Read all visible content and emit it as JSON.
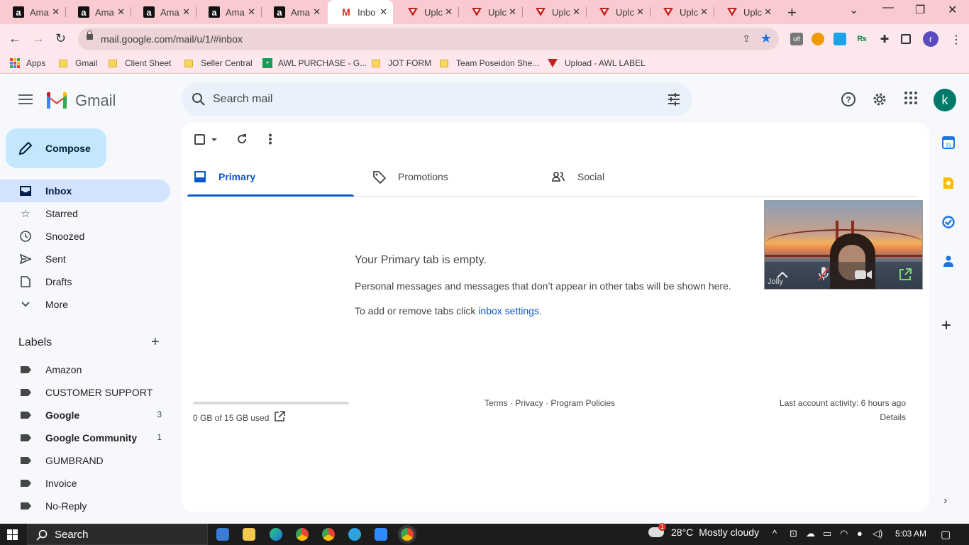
{
  "browser": {
    "tabs": [
      {
        "title": "Ama",
        "favicon": "amazon-icon",
        "active": false
      },
      {
        "title": "Ama",
        "favicon": "amazon-icon",
        "active": false
      },
      {
        "title": "Ama",
        "favicon": "amazon-icon",
        "active": false
      },
      {
        "title": "Ama",
        "favicon": "amazon-icon",
        "active": false
      },
      {
        "title": "Ama",
        "favicon": "amazon-icon",
        "active": false
      },
      {
        "title": "Inbo",
        "favicon": "gmail-icon",
        "active": true
      },
      {
        "title": "Uplc",
        "favicon": "upload-triangle-icon",
        "active": false
      },
      {
        "title": "Uplc",
        "favicon": "upload-triangle-icon",
        "active": false
      },
      {
        "title": "Uplc",
        "favicon": "upload-triangle-icon",
        "active": false
      },
      {
        "title": "Uplc",
        "favicon": "upload-triangle-icon",
        "active": false
      },
      {
        "title": "Uplc",
        "favicon": "upload-triangle-icon",
        "active": false
      },
      {
        "title": "Uplc",
        "favicon": "upload-triangle-icon",
        "active": false
      }
    ],
    "url": "mail.google.com/mail/u/1/#inbox",
    "profile_initial": "r",
    "extension_off_badge": "off",
    "colors": {
      "tabbar": "#f9cbd1",
      "toolbar": "#fce8ec"
    },
    "bookmarks": [
      {
        "label": "Apps",
        "icon": "apps-grid-icon"
      },
      {
        "label": "Gmail",
        "icon": "folder-icon"
      },
      {
        "label": "Client Sheet",
        "icon": "folder-icon"
      },
      {
        "label": "Seller Central",
        "icon": "folder-icon"
      },
      {
        "label": "AWL PURCHASE - G...",
        "icon": "sheets-icon"
      },
      {
        "label": "JOT FORM",
        "icon": "folder-icon"
      },
      {
        "label": "Team Poseidon She...",
        "icon": "folder-icon"
      },
      {
        "label": "Upload - AWL LABEL",
        "icon": "upload-triangle-icon"
      }
    ]
  },
  "gmail": {
    "logo_text": "Gmail",
    "search_placeholder": "Search mail",
    "avatar_initial": "k",
    "compose_label": "Compose",
    "nav": [
      {
        "label": "Inbox",
        "icon": "inbox-icon",
        "active": true
      },
      {
        "label": "Starred",
        "icon": "star-icon",
        "active": false
      },
      {
        "label": "Snoozed",
        "icon": "clock-icon",
        "active": false
      },
      {
        "label": "Sent",
        "icon": "send-icon",
        "active": false
      },
      {
        "label": "Drafts",
        "icon": "draft-icon",
        "active": false
      },
      {
        "label": "More",
        "icon": "chevron-down-icon",
        "active": false
      }
    ],
    "labels_heading": "Labels",
    "labels": [
      {
        "name": "Amazon",
        "count": "",
        "bold": false
      },
      {
        "name": "CUSTOMER SUPPORT",
        "count": "",
        "bold": false
      },
      {
        "name": "Google",
        "count": "3",
        "bold": true
      },
      {
        "name": "Google Community",
        "count": "1",
        "bold": true
      },
      {
        "name": "GUMBRAND",
        "count": "",
        "bold": false
      },
      {
        "name": "Invoice",
        "count": "",
        "bold": false
      },
      {
        "name": "No-Reply",
        "count": "",
        "bold": false
      }
    ],
    "inbox_tabs": [
      {
        "label": "Primary",
        "icon": "inbox-tab-icon",
        "active": true
      },
      {
        "label": "Promotions",
        "icon": "tag-icon",
        "active": false
      },
      {
        "label": "Social",
        "icon": "people-icon",
        "active": false
      }
    ],
    "empty_state": {
      "title": "Your Primary tab is empty.",
      "description": "Personal messages and messages that don’t appear in other tabs will be shown here.",
      "hint_prefix": "To add or remove tabs click ",
      "hint_link": "inbox settings",
      "hint_suffix": "."
    },
    "footer": {
      "storage_text": "0 GB of 15 GB used",
      "storage_used_fraction": 0.0,
      "links": "Terms · Privacy · Program Policies",
      "last_activity": "Last account activity: 6 hours ago",
      "details": "Details"
    },
    "video_call": {
      "participant_name": "Jolly"
    }
  },
  "taskbar": {
    "search_label": "Search",
    "weather_badge": "1",
    "temperature": "28°C",
    "weather": "Mostly cloudy",
    "time": "5:03 AM"
  }
}
